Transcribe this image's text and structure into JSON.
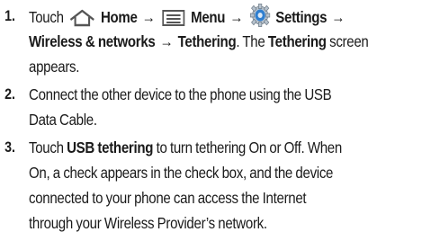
{
  "steps": [
    {
      "number": "1.",
      "touch": "Touch",
      "home": "Home",
      "menu": "Menu",
      "settings": "Settings",
      "arrow": "→",
      "wireless": "Wireless & networks",
      "tethering": "Tethering",
      "period1": ".",
      "the": "The",
      "tethering_screen": "Tethering",
      "screen_text": "screen",
      "appears": "appears.",
      "icons": [
        "home-icon",
        "menu-icon",
        "settings-gear-icon"
      ]
    },
    {
      "number": "2.",
      "line1": "Connect the other device to the phone using the USB",
      "line2": "Data Cable."
    },
    {
      "number": "3.",
      "touch": "Touch",
      "usb_tethering": "USB tethering",
      "line1_rest": "to turn tethering On or Off. When",
      "line2": "On, a check appears in the check box, and the device",
      "line3": "connected to your phone can access the Internet",
      "line4": "through your Wireless Provider’s network."
    }
  ],
  "colors": {
    "text": "#1a1a1a",
    "icon_outline": "#555555",
    "gear_blue": "#2f7fd0"
  }
}
